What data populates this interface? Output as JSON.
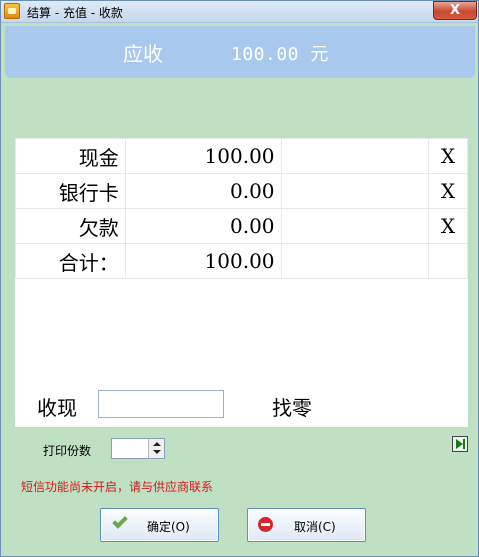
{
  "window": {
    "title": "结算 - 充值 - 收款",
    "close_glyph": "X"
  },
  "due": {
    "label": "应收",
    "amount": "100.00 元"
  },
  "payments": [
    {
      "label": "现金",
      "amount": "100.00",
      "remove": "X"
    },
    {
      "label": "银行卡",
      "amount": "0.00",
      "remove": "X"
    },
    {
      "label": "欠款",
      "amount": "0.00",
      "remove": "X"
    },
    {
      "label": "合计：",
      "amount": "100.00",
      "remove": ""
    }
  ],
  "received": {
    "label": "收现",
    "value": ""
  },
  "change": {
    "label": "找零"
  },
  "print": {
    "label": "打印份数",
    "value": ""
  },
  "sms_note": "短信功能尚未开启，请与供应商联系",
  "buttons": {
    "ok": "确定(O)",
    "cancel": "取消(C)"
  },
  "icons": {
    "app": "app-icon",
    "ok": "check-icon",
    "cancel": "no-entry-icon",
    "side": "play-next-icon"
  },
  "colors": {
    "window_bg": "#bfe0c3",
    "banner": "#a8c8ee",
    "note": "#d21a1a"
  }
}
